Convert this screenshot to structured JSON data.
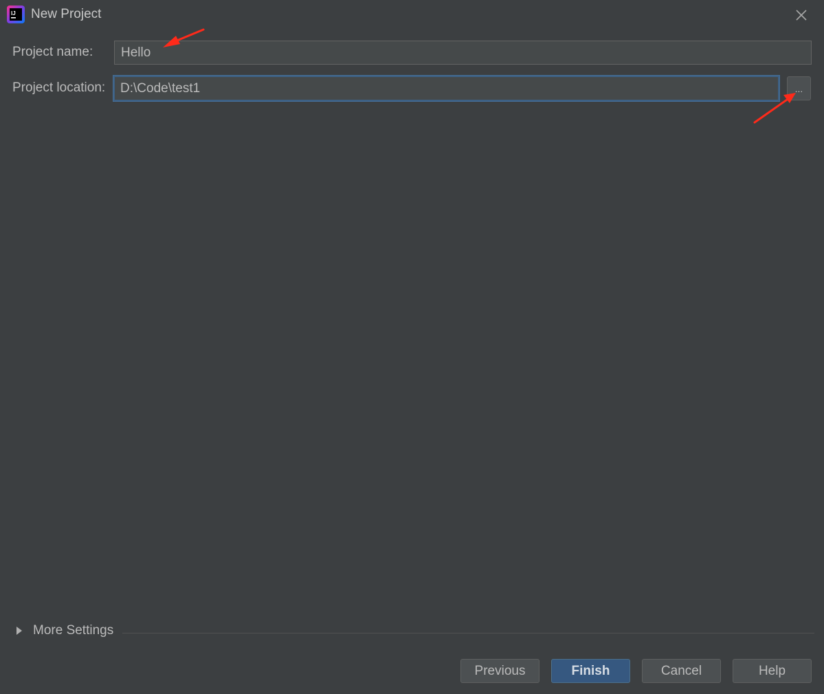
{
  "window": {
    "title": "New Project",
    "icon": "intellij-idea-icon"
  },
  "form": {
    "project_name_label": "Project name:",
    "project_name_value": "Hello",
    "project_location_label": "Project location:",
    "project_location_value": "D:\\Code\\test1",
    "browse_label": "..."
  },
  "more_settings": {
    "label": "More Settings"
  },
  "buttons": {
    "previous": "Previous",
    "finish": "Finish",
    "cancel": "Cancel",
    "help": "Help"
  },
  "colors": {
    "background": "#3c3f41",
    "primary_button": "#365880",
    "annotation_arrow": "#ff2a1a"
  }
}
